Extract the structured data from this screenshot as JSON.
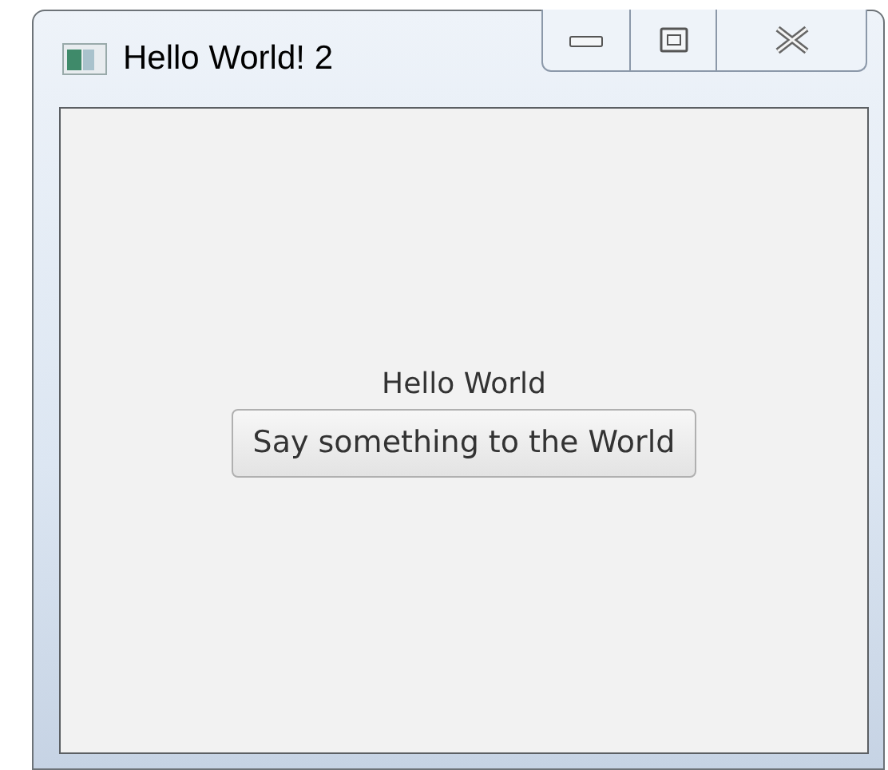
{
  "window": {
    "title": "Hello World! 2"
  },
  "content": {
    "label": "Hello World",
    "button": "Say something to the World"
  }
}
